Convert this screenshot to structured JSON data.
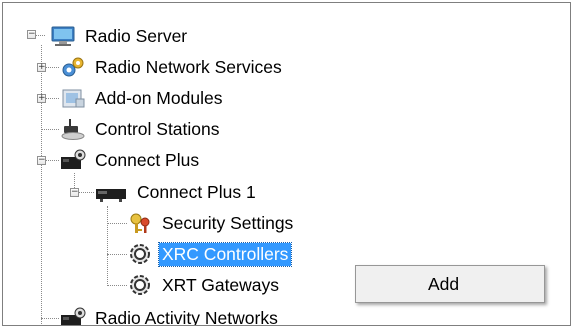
{
  "tree": {
    "root": {
      "label": "Radio Server",
      "icon": "computer-icon",
      "expander": "−"
    },
    "radio_network_services": {
      "label": "Radio Network Services",
      "icon": "gear-network-icon",
      "expander": "+"
    },
    "addon_modules": {
      "label": "Add-on Modules",
      "icon": "puzzle-module-icon",
      "expander": "+"
    },
    "control_stations": {
      "label": "Control Stations",
      "icon": "radio-station-icon"
    },
    "connect_plus": {
      "label": "Connect Plus",
      "icon": "repeater-icon",
      "expander": "−"
    },
    "connect_plus_1": {
      "label": "Connect Plus 1",
      "icon": "repeater-device-icon",
      "expander": "−"
    },
    "security_settings": {
      "label": "Security Settings",
      "icon": "keys-icon"
    },
    "xrc_controllers": {
      "label": "XRC Controllers",
      "icon": "gear-controller-icon",
      "selected": true
    },
    "xrt_gateways": {
      "label": "XRT Gateways",
      "icon": "gear-gateway-icon"
    },
    "radio_activity_networks": {
      "label": "Radio Activity Networks",
      "icon": "repeater-icon"
    }
  },
  "context_menu": {
    "items": [
      {
        "label": "Add"
      }
    ]
  },
  "colors": {
    "selection": "#3399ff",
    "menu_bg": "#f0f0f0"
  }
}
